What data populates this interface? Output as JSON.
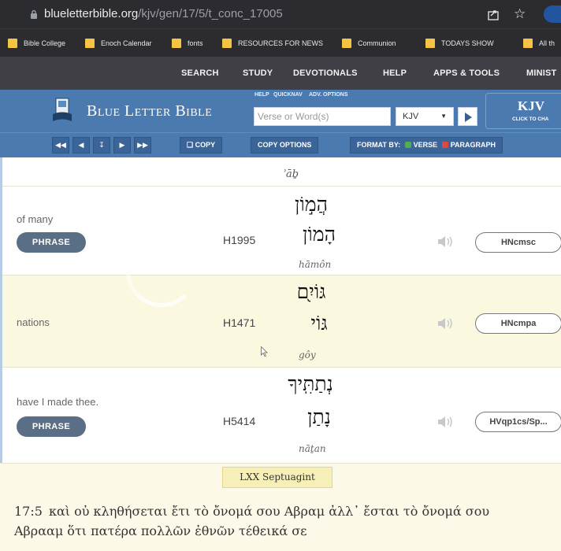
{
  "browser": {
    "url_host": "blueletterbible.org",
    "url_path": "/kjv/gen/17/5/t_conc_17005"
  },
  "bookmarks": [
    "Bible College",
    "Enoch Calendar",
    "fonts",
    "RESOURCES FOR NEWS",
    "Communion",
    "TODAYS SHOW",
    "All th"
  ],
  "topnav": [
    "SEARCH",
    "STUDY",
    "DEVOTIONALS",
    "HELP",
    "APPS & TOOLS",
    "MINIST"
  ],
  "header": {
    "logo_text": "Blue Letter Bible",
    "mini_links": [
      "HELP",
      "QUICKNAV",
      "ADV. OPTIONS"
    ],
    "search_placeholder": "Verse or Word(s)",
    "version": "KJV",
    "version_banner": "KJV",
    "version_banner_sub": "CLICK TO CHA"
  },
  "toolbar": {
    "copy": "COPY",
    "copy_options": "COPY OPTIONS",
    "format_by": "FORMAT BY:",
    "verse": "VERSE",
    "paragraph": "PARAGRAPH"
  },
  "top_translit": "ʾāḇ",
  "rows": [
    {
      "english": "of many",
      "phrase": "PHRASE",
      "strongs": "H1995",
      "hebrew_text": "הֲמ֣וֹן",
      "hebrew_root": "הָמוֹן",
      "translit": "hāmôn",
      "morph": "HNcmsc"
    },
    {
      "english": "nations",
      "phrase": "",
      "strongs": "H1471",
      "hebrew_text": "גּוֹיִ֖ם",
      "hebrew_root": "גּוֹי",
      "translit": "gôy",
      "morph": "HNcmpa"
    },
    {
      "english": "have I made thee.",
      "phrase": "PHRASE",
      "strongs": "H5414",
      "hebrew_text": "נְתַתִּֽיךָ",
      "hebrew_root": "נָתַן",
      "translit": "nāṯan",
      "morph": "HVqp1cs/Sp..."
    }
  ],
  "lxx": {
    "tab": "LXX Septuagint",
    "ref": "17:5",
    "text_line1": "καὶ οὐ κληθήσεται ἔτι τὸ ὄνομά σου Αβραμ ἀλλ᾽ ἔσται τὸ ὄνομά σου",
    "text_line2": "Αβρααμ ὅτι πατέρα πολλῶν ἐθνῶν τέθεικά σε"
  },
  "colors": {
    "header_blue": "#4a7ab0",
    "row_alt": "#fbf8e0",
    "phrase_button": "#5a6f86"
  }
}
